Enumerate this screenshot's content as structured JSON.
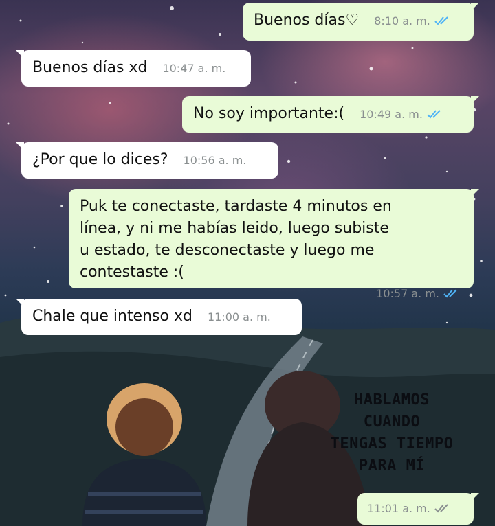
{
  "messages": [
    {
      "direction": "out",
      "text": "Buenos días♡",
      "time": "8:10 a. m.",
      "status": "read"
    },
    {
      "direction": "in",
      "text": "Buenos días xd",
      "time": "10:47 a. m."
    },
    {
      "direction": "out",
      "text": "No soy importante:(",
      "time": "10:49 a. m.",
      "status": "read"
    },
    {
      "direction": "in",
      "text": "¿Por que lo dices?",
      "time": "10:56 a. m."
    },
    {
      "direction": "out",
      "text": "Puk te conectaste, tardaste 4 minutos en\nlínea, y ni me habías leido, luego subiste\nu  estado, te desconectaste y luego me\ncontestaste :(",
      "time": "10:57 a. m.",
      "status": "read"
    },
    {
      "direction": "in",
      "text": "Chale que intenso xd",
      "time": "11:00 a. m."
    },
    {
      "direction": "out",
      "text": "",
      "time": "11:01 a. m.",
      "status": "sent"
    }
  ],
  "image_caption": "HABLAMOS CUANDO\nTENGAS TIEMPO\nPARA MÍ",
  "colors": {
    "incoming_bubble": "#ffffff",
    "outgoing_bubble": "#e9fbd7",
    "read_ticks": "#4fb3f6",
    "sent_ticks": "#8a8f90"
  }
}
